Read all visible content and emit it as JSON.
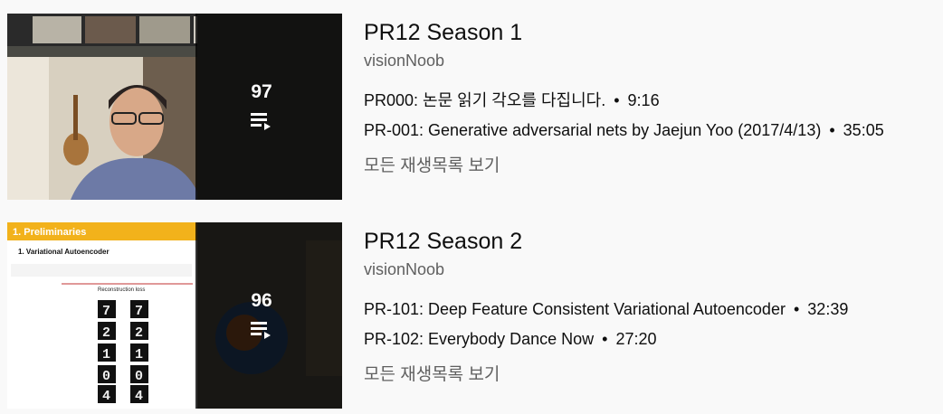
{
  "playlists": [
    {
      "count": "97",
      "title": "PR12 Season 1",
      "channel": "visionNoob",
      "videos": [
        {
          "title": "PR000: 논문 읽기 각오를 다집니다.",
          "sep": "•",
          "duration": "9:16"
        },
        {
          "title": "PR-001: Generative adversarial nets by Jaejun Yoo (2017/4/13)",
          "sep": "•",
          "duration": "35:05"
        }
      ],
      "view_all": "모든 재생목록 보기"
    },
    {
      "count": "96",
      "title": "PR12 Season 2",
      "channel": "visionNoob",
      "videos": [
        {
          "title": "PR-101: Deep Feature Consistent Variational Autoencoder",
          "sep": "•",
          "duration": "32:39"
        },
        {
          "title": "PR-102: Everybody Dance Now",
          "sep": "•",
          "duration": "27:20"
        }
      ],
      "view_all": "모든 재생목록 보기"
    }
  ],
  "thumbnail2_text": {
    "header": "1. Preliminaries",
    "subheader": "1. Variational Autoencoder",
    "caption": "Reconstruction loss",
    "digits": [
      "7",
      "7",
      "2",
      "2",
      "1",
      "1",
      "0",
      "0",
      "4",
      "4"
    ]
  },
  "icons": {
    "playlist": "playlist-icon"
  }
}
